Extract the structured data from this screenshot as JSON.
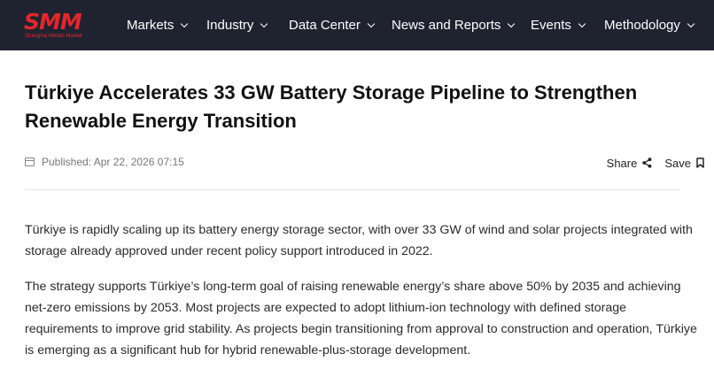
{
  "logo": {
    "name": "SMM",
    "tagline": "Shanghai Metals Market",
    "color": "#e3262b"
  },
  "nav": {
    "items": [
      {
        "label": "Markets"
      },
      {
        "label": "Industry"
      },
      {
        "label": "Data Center"
      },
      {
        "label": "News and Reports"
      },
      {
        "label": "Events"
      },
      {
        "label": "Methodology"
      }
    ],
    "background": "#1f2330"
  },
  "article": {
    "title": "Türkiye Accelerates 33 GW Battery Storage Pipeline to Strengthen Renewable Energy Transition",
    "published": "Published: Apr 22, 2026 07:15",
    "share_label": "Share",
    "save_label": "Save",
    "paragraphs": [
      "Türkiye is rapidly scaling up its battery energy storage sector, with over 33 GW of wind and solar projects integrated with storage already approved under recent policy support introduced in 2022.",
      "The strategy supports Türkiye’s long-term goal of raising renewable energy’s share above 50% by 2035 and achieving net-zero emissions by 2053. Most projects are expected to adopt lithium-ion technology with defined storage requirements to improve grid stability. As projects begin transitioning from approval to construction and operation, Türkiye is emerging as a significant hub for hybrid renewable-plus-storage development."
    ]
  }
}
